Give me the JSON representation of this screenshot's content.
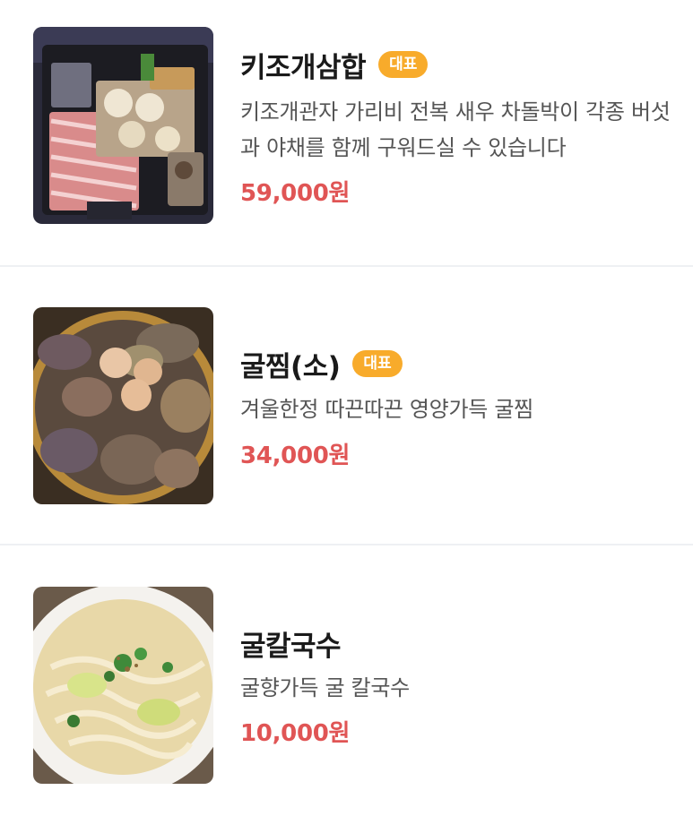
{
  "menu": {
    "items": [
      {
        "name": "키조개삼합",
        "badge": "대표",
        "description": "키조개관자 가리비 전복 새우 차돌박이 각종 버섯과 야채를 함께 구워드실 수 있습니다",
        "price": "59,000원"
      },
      {
        "name": "굴찜(소)",
        "badge": "대표",
        "description": "겨울한정 따끈따끈 영양가득 굴찜",
        "price": "34,000원"
      },
      {
        "name": "굴칼국수",
        "description": "굴향가득 굴 칼국수",
        "price": "10,000원"
      }
    ]
  },
  "colors": {
    "badge": "#f8ab2b",
    "price": "#e05555",
    "title": "#1a1a1a",
    "description": "#555555",
    "divider": "#eef0f3"
  }
}
